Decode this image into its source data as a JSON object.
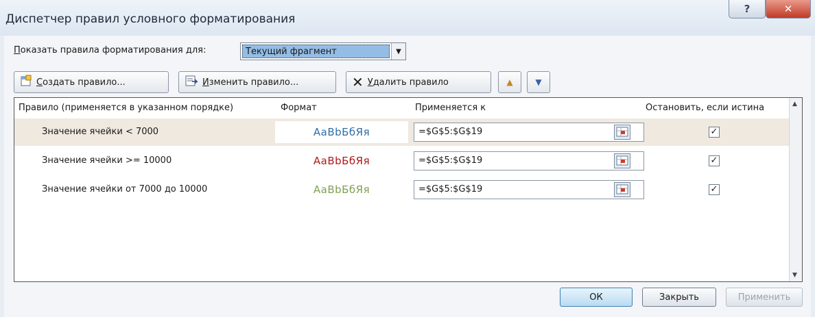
{
  "window": {
    "title": "Диспетчер правил условного форматирования"
  },
  "show_rules": {
    "label": "оказать правила форматирования для:",
    "label_accel": "П",
    "selected": "Текущий фрагмент"
  },
  "toolbar": {
    "create_accel": "С",
    "create_rest": "оздать правило...",
    "edit_accel": "И",
    "edit_rest": "зменить правило...",
    "delete_accel": "У",
    "delete_rest": "далить правило"
  },
  "grid": {
    "headers": {
      "rule": "Правило (применяется в указанном порядке)",
      "format": "Формат",
      "applies": "Применяется к",
      "stop": "Остановить, если истина"
    },
    "rows": [
      {
        "rule": "Значение ячейки < 7000",
        "preview": "АаBbБбЯя",
        "preview_color": "#2e6ea8",
        "applies": "=$G$5:$G$19",
        "stop": true,
        "selected": true
      },
      {
        "rule": "Значение ячейки >= 10000",
        "preview": "АаBbБбЯя",
        "preview_color": "#b01818",
        "applies": "=$G$5:$G$19",
        "stop": true,
        "selected": false
      },
      {
        "rule": "Значение ячейки от 7000 до 10000",
        "preview": "АаBbБбЯя",
        "preview_color": "#7ea050",
        "applies": "=$G$5:$G$19",
        "stop": true,
        "selected": false
      }
    ]
  },
  "buttons": {
    "ok": "ОК",
    "close": "Закрыть",
    "apply": "Применить"
  }
}
